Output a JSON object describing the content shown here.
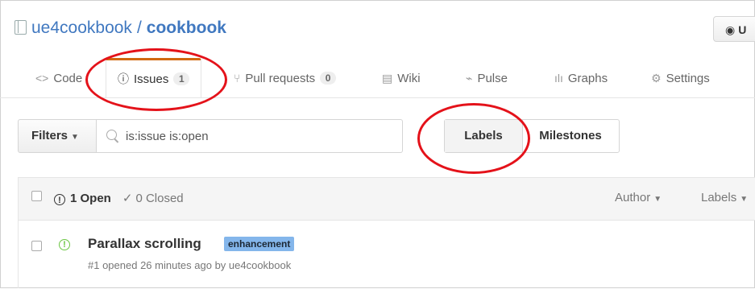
{
  "repo": {
    "owner": "ue4cookbook",
    "separator": "/",
    "name": "cookbook"
  },
  "watch_button": {
    "label": "U",
    "icon": "eye-icon"
  },
  "tabs": [
    {
      "label": "Code",
      "icon": "<>"
    },
    {
      "label": "Issues",
      "icon": "issue-opened-icon",
      "count": "1",
      "selected": true
    },
    {
      "label": "Pull requests",
      "icon": "pull-request-icon",
      "count": "0"
    },
    {
      "label": "Wiki",
      "icon": "book-icon"
    },
    {
      "label": "Pulse",
      "icon": "pulse-icon"
    },
    {
      "label": "Graphs",
      "icon": "graph-icon"
    },
    {
      "label": "Settings",
      "icon": "gear-icon"
    }
  ],
  "filters": {
    "label": "Filters",
    "search_value": "is:issue is:open"
  },
  "nav_buttons": {
    "labels": "Labels",
    "milestones": "Milestones"
  },
  "issues_header": {
    "open_count_label": "1 Open",
    "closed_count_label": "0 Closed",
    "author_menu": "Author",
    "labels_menu": "Labels"
  },
  "issues": [
    {
      "title": "Parallax scrolling",
      "label": "enhancement",
      "meta": "#1 opened 26 minutes ago by ue4cookbook"
    }
  ],
  "colors": {
    "link": "#4078c0",
    "selected_tab_accent": "#d26911",
    "open_issue": "#6cc644",
    "label_enhancement": "#84b6eb",
    "annotation": "#e4121a"
  }
}
